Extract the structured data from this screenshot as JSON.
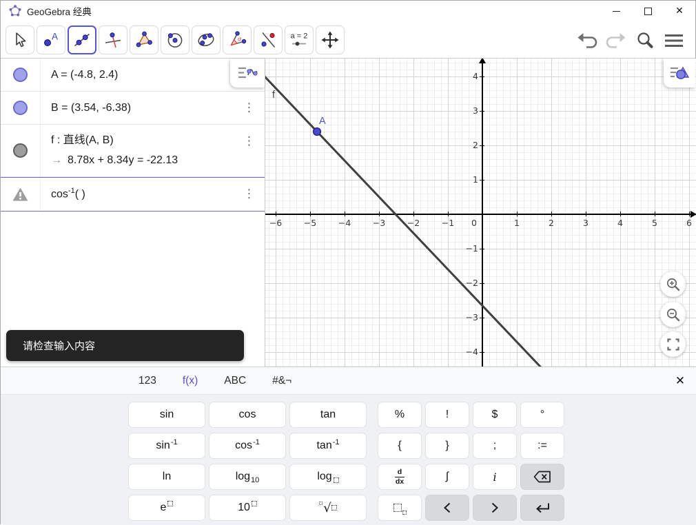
{
  "window": {
    "title": "GeoGebra 经典",
    "controls": [
      {
        "name": "minimize-button",
        "icon": "minimize"
      },
      {
        "name": "maximize-button",
        "icon": "maximize"
      },
      {
        "name": "close-button",
        "icon": "close"
      }
    ]
  },
  "toolbar": {
    "tools": [
      {
        "name": "move-tool",
        "icon": "pointer",
        "selected": false
      },
      {
        "name": "point-tool",
        "icon": "point",
        "selected": false
      },
      {
        "name": "line-tool",
        "icon": "line",
        "selected": true
      },
      {
        "name": "perpendicular-line-tool",
        "icon": "perp",
        "selected": false
      },
      {
        "name": "polygon-tool",
        "icon": "polygon",
        "selected": false
      },
      {
        "name": "circle-tool",
        "icon": "circle",
        "selected": false
      },
      {
        "name": "ellipse-tool",
        "icon": "ellipse",
        "selected": false
      },
      {
        "name": "angle-tool",
        "icon": "angle",
        "selected": false
      },
      {
        "name": "reflect-tool",
        "icon": "reflect",
        "selected": false
      },
      {
        "name": "slider-tool",
        "icon": "slider",
        "selected": false,
        "icon_text": "a = 2"
      },
      {
        "name": "move-graphics-tool",
        "icon": "movegfx",
        "selected": false
      }
    ],
    "right": [
      {
        "name": "undo-button",
        "icon": "undo"
      },
      {
        "name": "redo-button",
        "icon": "redo"
      },
      {
        "name": "search-button",
        "icon": "search"
      },
      {
        "name": "menu-button",
        "icon": "menu"
      }
    ]
  },
  "algebra": {
    "rows": [
      {
        "marble": "pt",
        "lines": [
          [
            {
              "t": "txt",
              "v": "A = (-4.8, 2.4)"
            }
          ]
        ],
        "menu": false
      },
      {
        "marble": "pt",
        "lines": [
          [
            {
              "t": "txt",
              "v": "B = (3.54, -6.38)"
            }
          ]
        ],
        "menu": true
      },
      {
        "marble": "ln",
        "lines": [
          [
            {
              "t": "txt",
              "v": "f : 直线(A, B)"
            }
          ],
          [
            {
              "t": "arrow",
              "v": "→"
            },
            {
              "t": "txt",
              "v": "8.78x + 8.34y = -22.13"
            }
          ]
        ],
        "menu": true
      },
      {
        "marble": "warn",
        "lines": [
          [
            {
              "t": "txt",
              "v": "cos"
            },
            {
              "t": "sup",
              "v": "-1"
            },
            {
              "t": "txt",
              "v": "( )"
            }
          ]
        ],
        "menu": true,
        "selected": true
      }
    ],
    "tooltip": "请检查输入内容"
  },
  "graphics": {
    "xticks": [
      -6,
      -5,
      -4,
      -3,
      -2,
      -1,
      0,
      1,
      2,
      3,
      4,
      5,
      6
    ],
    "yticks": [
      -4,
      -3,
      -2,
      -1,
      1,
      2,
      3,
      4
    ],
    "points": [
      {
        "label": "A",
        "x": -4.8,
        "y": 2.4,
        "color": "#4848cf",
        "stroke": "#23238f",
        "label_color": "#5252d8"
      }
    ],
    "line": {
      "label": "f",
      "through": [
        [
          -4.8,
          2.4
        ],
        [
          3.54,
          -6.38
        ]
      ],
      "equation": "8.78x + 8.34y = -22.13",
      "color": "#3f3f3f",
      "label_color": "#3f3f3f"
    }
  },
  "keyboard": {
    "tabs": [
      {
        "name": "tab-123",
        "label": "123",
        "active": false
      },
      {
        "name": "tab-fx",
        "label": "f(x)",
        "active": true
      },
      {
        "name": "tab-abc",
        "label": "ABC",
        "active": false
      },
      {
        "name": "tab-special",
        "label": "#&¬",
        "active": false
      }
    ],
    "close_icon": "close-keyboard",
    "rows": [
      [
        {
          "name": "key-sin",
          "k": "txt",
          "v": "sin",
          "wide": true
        },
        {
          "name": "key-cos",
          "k": "txt",
          "v": "cos",
          "wide": true
        },
        {
          "name": "key-tan",
          "k": "txt",
          "v": "tan",
          "wide": true
        },
        {
          "name": "key-percent",
          "k": "txt",
          "v": "%",
          "gap": true
        },
        {
          "name": "key-exclamation",
          "k": "txt",
          "v": "!"
        },
        {
          "name": "key-dollar",
          "k": "txt",
          "v": "$"
        },
        {
          "name": "key-degree",
          "k": "txt",
          "v": "°"
        }
      ],
      [
        {
          "name": "key-arcsin",
          "k": "sup",
          "b": "sin",
          "s": "-1",
          "wide": true
        },
        {
          "name": "key-arccos",
          "k": "sup",
          "b": "cos",
          "s": "-1",
          "wide": true
        },
        {
          "name": "key-arctan",
          "k": "sup",
          "b": "tan",
          "s": "-1",
          "wide": true
        },
        {
          "name": "key-brace-open",
          "k": "txt",
          "v": "{",
          "gap": true
        },
        {
          "name": "key-brace-close",
          "k": "txt",
          "v": "}"
        },
        {
          "name": "key-semicolon",
          "k": "txt",
          "v": ";"
        },
        {
          "name": "key-assign",
          "k": "txt",
          "v": ":="
        }
      ],
      [
        {
          "name": "key-ln",
          "k": "txt",
          "v": "ln",
          "wide": true
        },
        {
          "name": "key-log10",
          "k": "sub",
          "b": "log",
          "s": "10",
          "wide": true
        },
        {
          "name": "key-logb",
          "k": "logbox",
          "b": "log",
          "wide": true
        },
        {
          "name": "key-derivative",
          "k": "frac",
          "n": "d",
          "d": "dx",
          "gap": true
        },
        {
          "name": "key-integral",
          "k": "txt",
          "v": "∫"
        },
        {
          "name": "key-imaginary",
          "k": "ital",
          "v": "i"
        },
        {
          "name": "key-backspace",
          "k": "svg",
          "v": "backspace",
          "dark": true
        }
      ],
      [
        {
          "name": "key-e-power",
          "k": "supbox",
          "b": "e",
          "wide": true
        },
        {
          "name": "key-ten-power",
          "k": "supbox",
          "b": "10",
          "wide": true
        },
        {
          "name": "key-nroot",
          "k": "root",
          "wide": true
        },
        {
          "name": "key-subscript",
          "k": "idx",
          "gap": true
        },
        {
          "name": "key-left-arrow",
          "k": "svg",
          "v": "chevleft",
          "dark": true
        },
        {
          "name": "key-right-arrow",
          "k": "svg",
          "v": "chevright",
          "dark": true
        },
        {
          "name": "key-enter",
          "k": "svg",
          "v": "enter",
          "dark": true
        }
      ]
    ]
  }
}
